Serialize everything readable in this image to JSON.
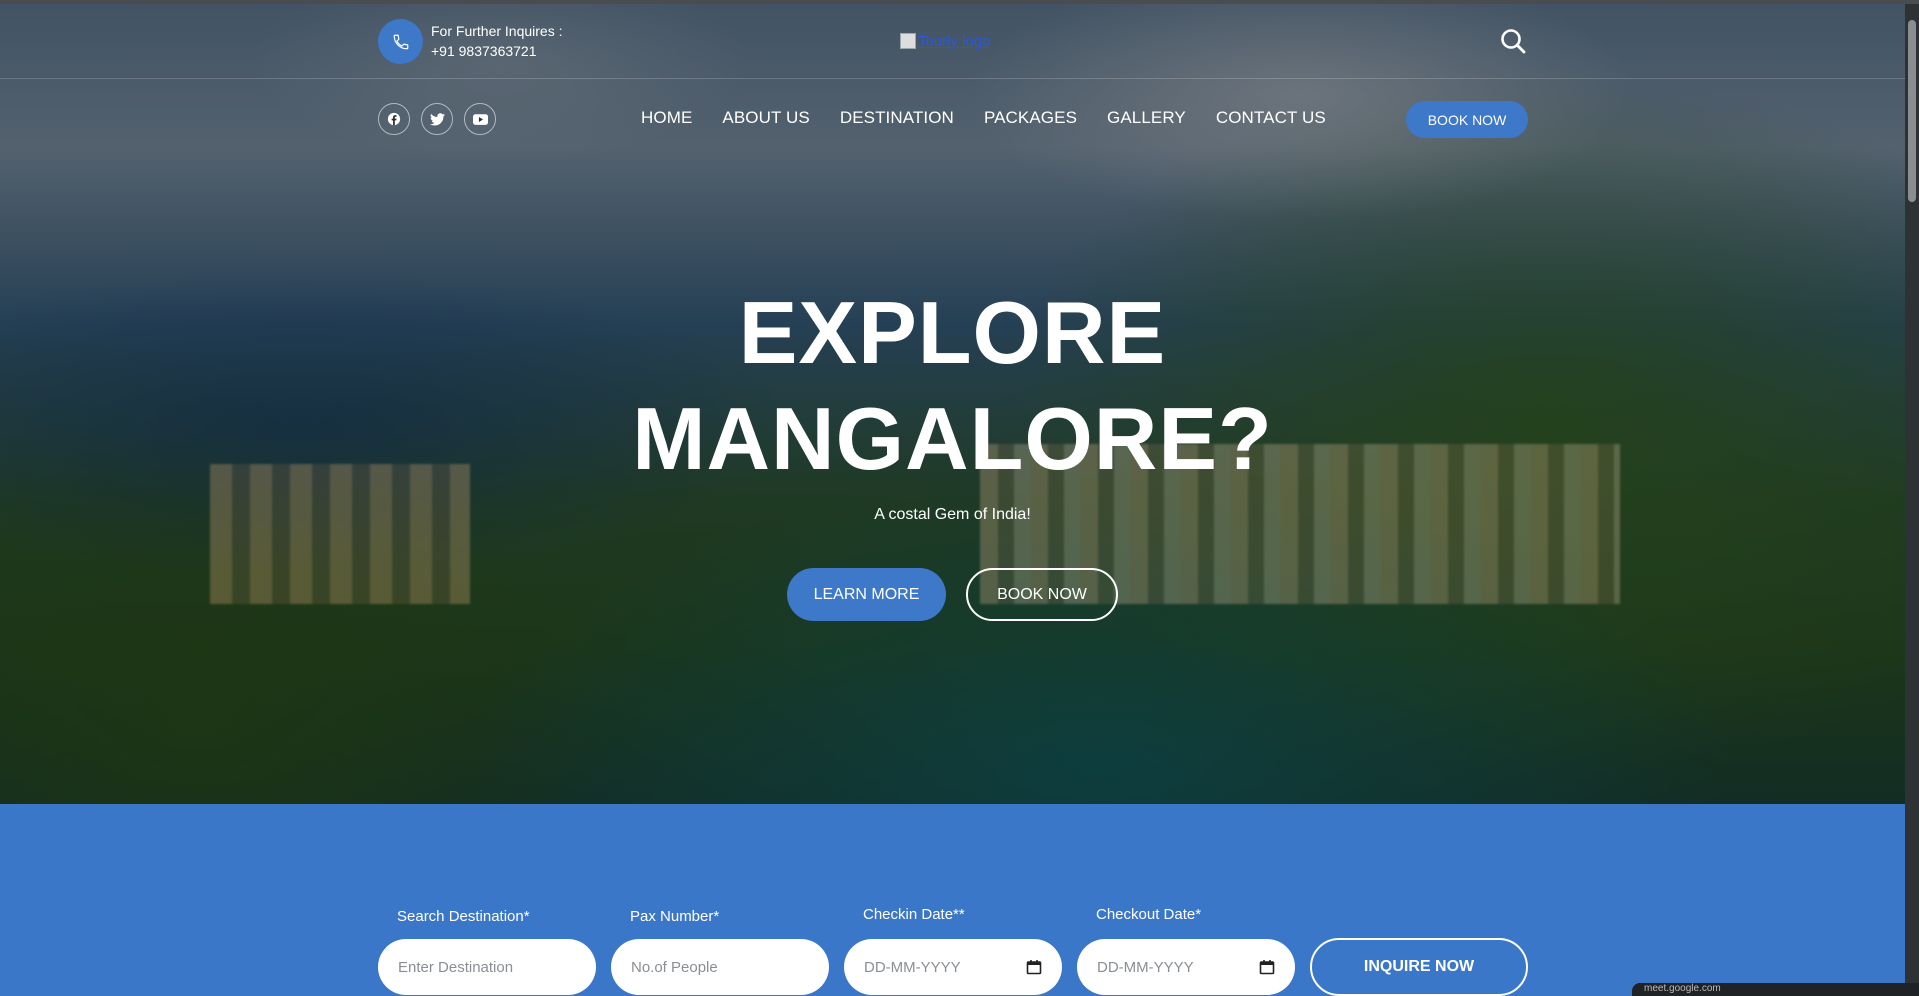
{
  "header": {
    "phone_label": "For Further Inquires :",
    "phone_number": "+91 9837363721",
    "logo_alt": "Tourly logo"
  },
  "nav": {
    "items": [
      "HOME",
      "ABOUT US",
      "DESTINATION",
      "PACKAGES",
      "GALLERY",
      "CONTACT US"
    ],
    "book_label": "BOOK NOW"
  },
  "social": [
    "facebook-icon",
    "twitter-icon",
    "youtube-icon"
  ],
  "hero": {
    "title_line1": "EXPLORE",
    "title_line2": "MANGALORE?",
    "subtitle": "A costal Gem of India!",
    "learn_more": "LEARN MORE",
    "book_now": "BOOK NOW"
  },
  "inquiry": {
    "destination_label": "Search Destination*",
    "destination_placeholder": "Enter Destination",
    "pax_label": "Pax Number*",
    "pax_placeholder": "No.of People",
    "checkin_label": "Checkin Date**",
    "checkin_placeholder": "DD-MM-YYYY",
    "checkout_label": "Checkout Date*",
    "checkout_placeholder": "DD-MM-YYYY",
    "submit_label": "INQUIRE NOW"
  },
  "status_bar": "meet.google.com",
  "colors": {
    "accent": "#3d78c9",
    "band": "#3b77c9"
  }
}
